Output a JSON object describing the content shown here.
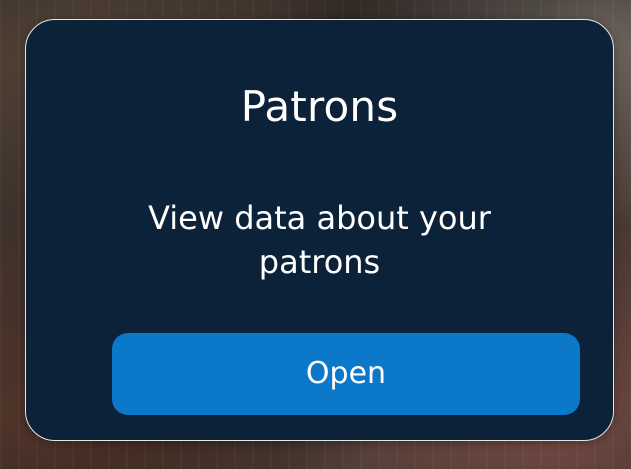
{
  "card": {
    "title": "Patrons",
    "description": "View data about your patrons",
    "open_label": "Open"
  },
  "colors": {
    "card_background": "#0b2239",
    "button": "#0b78c9",
    "text": "#ffffff"
  }
}
